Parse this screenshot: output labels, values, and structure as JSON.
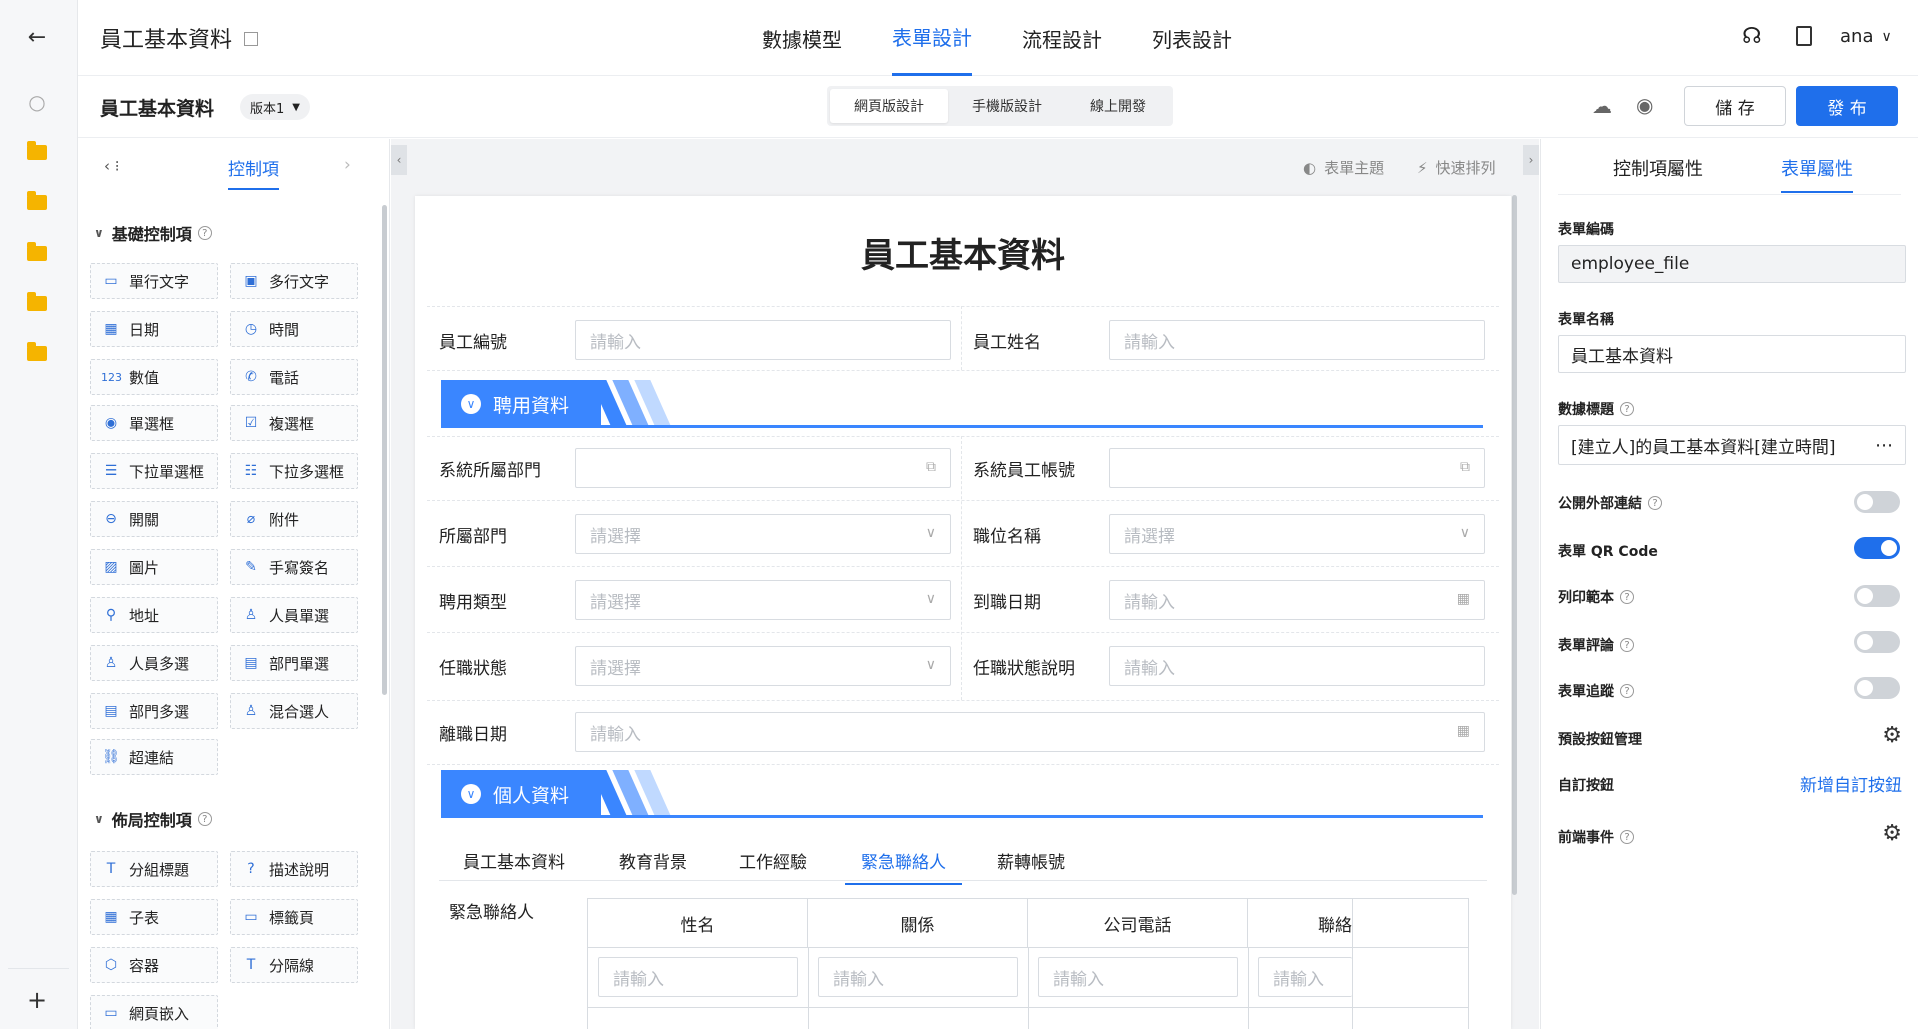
{
  "rail": {
    "icons": [
      "back-arrow-icon",
      "search-icon",
      "folder-icon",
      "folder-icon",
      "folder-icon",
      "folder-icon",
      "folder-icon",
      "plus-icon"
    ]
  },
  "header": {
    "title": "員工基本資料",
    "tabs": [
      {
        "label": "數據模型"
      },
      {
        "label": "表單設計",
        "active": true
      },
      {
        "label": "流程設計"
      },
      {
        "label": "列表設計"
      }
    ],
    "user": "ana"
  },
  "toolbar": {
    "form_title": "員工基本資料",
    "version": "版本1",
    "modes": [
      "網頁版設計",
      "手機版設計",
      "線上開發"
    ],
    "save_label": "儲 存",
    "publish_label": "發 布"
  },
  "left_panel": {
    "tab_label": "控制項",
    "basic_title": "基礎控制項",
    "basic_items": [
      "單行文字",
      "多行文字",
      "日期",
      "時間",
      "數值",
      "電話",
      "單選框",
      "複選框",
      "下拉單選框",
      "下拉多選框",
      "開關",
      "附件",
      "圖片",
      "手寫簽名",
      "地址",
      "人員單選",
      "人員多選",
      "部門單選",
      "部門多選",
      "混合選人",
      "超連結"
    ],
    "layout_title": "佈局控制項",
    "layout_items": [
      "分組標題",
      "描述說明",
      "子表",
      "標籤頁",
      "容器",
      "分隔線",
      "網頁嵌入"
    ]
  },
  "canvas": {
    "theme_label": "表單主題",
    "arrange_label": "快速排列",
    "form_heading": "員工基本資料",
    "placeholder_input": "請輸入",
    "placeholder_select": "請選擇",
    "fields": {
      "emp_no": "員工編號",
      "emp_name": "員工姓名",
      "sys_dept": "系統所屬部門",
      "sys_account": "系統員工帳號",
      "dept": "所屬部門",
      "position": "職位名稱",
      "hire_type": "聘用類型",
      "hire_date": "到職日期",
      "status": "任職狀態",
      "status_desc": "任職狀態說明",
      "leave_date": "離職日期"
    },
    "section1": "聘用資料",
    "section2": "個人資料",
    "tabs": [
      "員工基本資料",
      "教育背景",
      "工作經驗",
      "緊急聯絡人",
      "薪轉帳號"
    ],
    "active_tab": "緊急聯絡人",
    "subtable_label": "緊急聯絡人",
    "subtable_cols": [
      "性名",
      "關係",
      "公司電話",
      "聯絡"
    ]
  },
  "right_panel": {
    "tabs": [
      "控制項屬性",
      "表單屬性"
    ],
    "code_label": "表單編碼",
    "code_value": "employee_file",
    "name_label": "表單名稱",
    "name_value": "員工基本資料",
    "data_title_label": "數據標題",
    "data_title_value": "[建立人]的員工基本資料[建立時間]",
    "toggles": [
      {
        "label": "公開外部連結",
        "on": false
      },
      {
        "label": "表單 QR Code",
        "on": true
      },
      {
        "label": "列印範本",
        "on": false
      },
      {
        "label": "表單評論",
        "on": false
      },
      {
        "label": "表單追蹤",
        "on": false
      }
    ],
    "default_buttons_label": "預設按鈕管理",
    "custom_buttons_label": "自訂按鈕",
    "add_custom_button": "新增自訂按鈕",
    "frontend_events_label": "前端事件"
  },
  "colors": {
    "accent": "#1f6feb",
    "section_blue": "#3a86ff",
    "folder": "#f5b400"
  }
}
